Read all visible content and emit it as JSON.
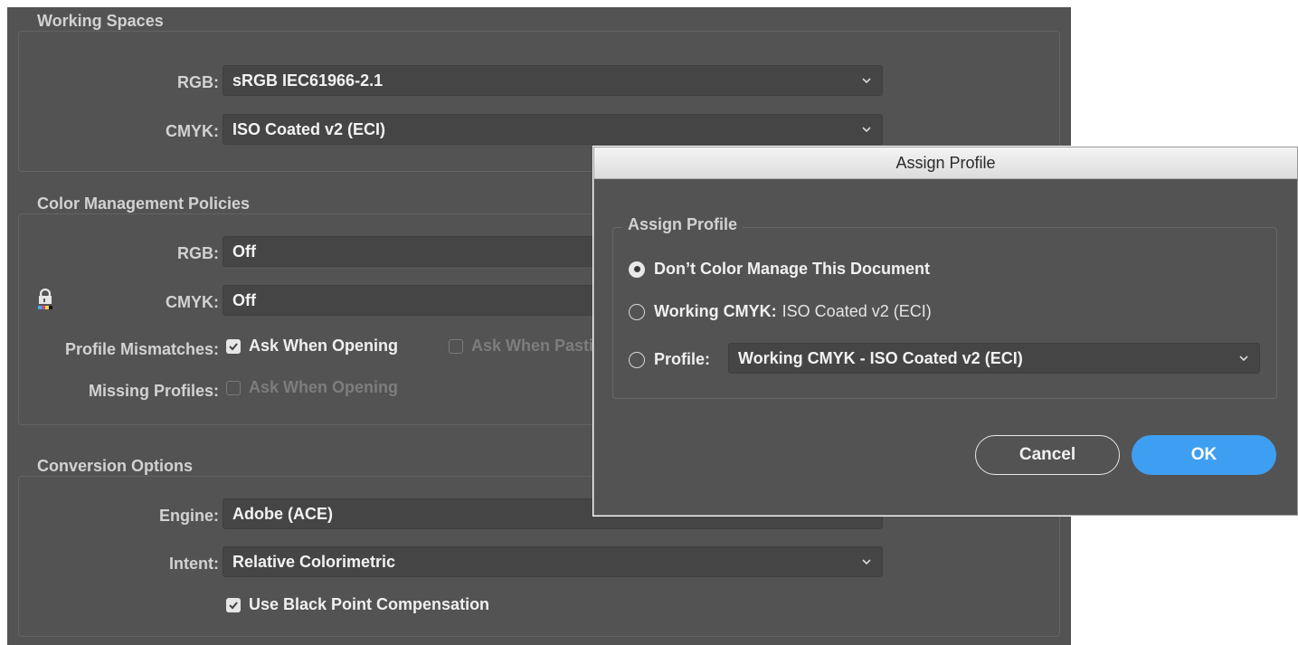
{
  "working_spaces": {
    "title": "Working Spaces",
    "rgb_label": "RGB:",
    "rgb_value": "sRGB IEC61966-2.1",
    "cmyk_label": "CMYK:",
    "cmyk_value": "ISO Coated v2 (ECI)"
  },
  "policies": {
    "title": "Color Management Policies",
    "rgb_label": "RGB:",
    "rgb_value": "Off",
    "cmyk_label": "CMYK:",
    "cmyk_value": "Off",
    "mismatch_label": "Profile Mismatches:",
    "ask_opening": "Ask When Opening",
    "ask_pasting": "Ask When Pasting",
    "missing_label": "Missing Profiles:",
    "missing_ask_opening": "Ask When Opening"
  },
  "conversion": {
    "title": "Conversion Options",
    "engine_label": "Engine:",
    "engine_value": "Adobe (ACE)",
    "intent_label": "Intent:",
    "intent_value": "Relative Colorimetric",
    "bpc_label": "Use Black Point Compensation"
  },
  "dialog": {
    "window_title": "Assign Profile",
    "group_title": "Assign Profile",
    "option_dont": "Don’t Color Manage This Document",
    "option_working_label": "Working CMYK:",
    "option_working_value": "ISO Coated v2 (ECI)",
    "option_profile_label": "Profile:",
    "profile_value": "Working CMYK - ISO Coated v2 (ECI)",
    "cancel_label": "Cancel",
    "ok_label": "OK"
  },
  "colors": {
    "panel_bg": "#535353",
    "field_bg": "#454545",
    "ok_blue": "#3e9ff2"
  },
  "icons": [
    "chevron-down-icon",
    "lock-icon",
    "checkbox-checked-icon",
    "radio-icon"
  ]
}
